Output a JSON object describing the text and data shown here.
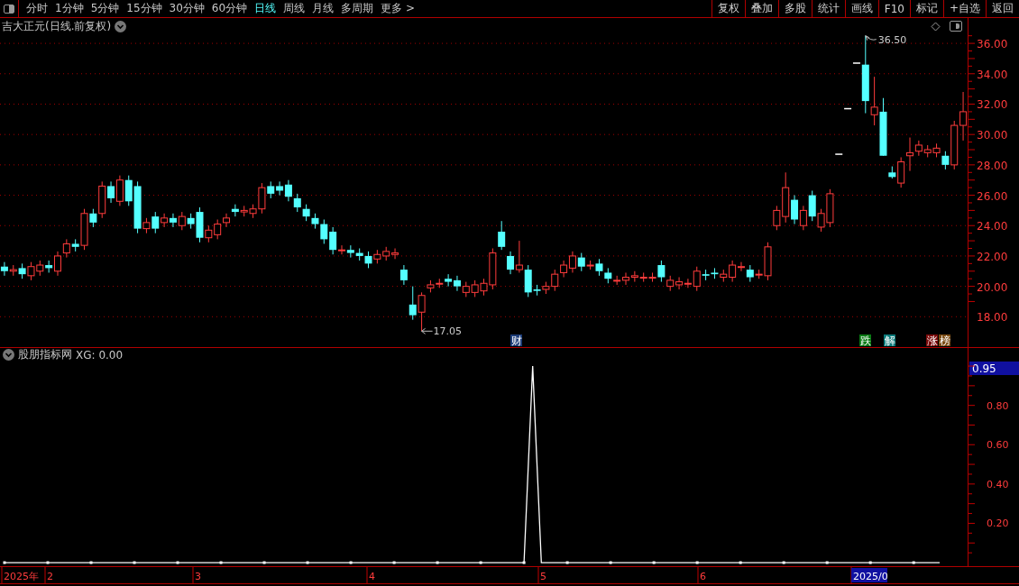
{
  "toolbar": {
    "periods": [
      {
        "label": "分时",
        "selected": false
      },
      {
        "label": "1分钟",
        "selected": false
      },
      {
        "label": "5分钟",
        "selected": false
      },
      {
        "label": "15分钟",
        "selected": false
      },
      {
        "label": "30分钟",
        "selected": false
      },
      {
        "label": "60分钟",
        "selected": false
      },
      {
        "label": "日线",
        "selected": true
      },
      {
        "label": "周线",
        "selected": false
      },
      {
        "label": "月线",
        "selected": false
      },
      {
        "label": "多周期",
        "selected": false
      },
      {
        "label": "更多 >",
        "selected": false
      }
    ],
    "actions": [
      "复权",
      "叠加",
      "多股",
      "统计",
      "画线",
      "F10",
      "标记",
      "+自选",
      "返回"
    ]
  },
  "price_chart": {
    "title": "吉大正元(日线.前复权)",
    "high_label": "36.50",
    "low_label": "17.05",
    "events": [
      {
        "label": "财",
        "color": "#1c3c78"
      },
      {
        "label": "跌",
        "color": "#0a7a14"
      },
      {
        "label": "解",
        "color": "#0a7a7a"
      },
      {
        "label": "涨",
        "color": "#7a0a0a"
      },
      {
        "label": "榜",
        "color": "#7a4a10"
      }
    ],
    "chart_data": {
      "type": "candlestick",
      "ylim": [
        16,
        36.6
      ],
      "grid": true,
      "yticks": [
        {
          "value": 36,
          "label": "36.00"
        },
        {
          "value": 34,
          "label": "34.00"
        },
        {
          "value": 32,
          "label": "32.00"
        },
        {
          "value": 30,
          "label": "30.00"
        },
        {
          "value": 28,
          "label": "28.00"
        },
        {
          "value": 26,
          "label": "26.00"
        },
        {
          "value": 24,
          "label": "24.00"
        },
        {
          "value": 22,
          "label": "22.00"
        },
        {
          "value": 20,
          "label": "20.00"
        },
        {
          "value": 18,
          "label": "18.00"
        }
      ],
      "ohlc": [
        [
          21.3,
          21.6,
          20.7,
          21.0
        ],
        [
          21.0,
          21.4,
          20.7,
          21.1
        ],
        [
          21.2,
          21.5,
          20.5,
          20.8
        ],
        [
          20.7,
          21.6,
          20.4,
          21.3
        ],
        [
          21.0,
          21.7,
          20.7,
          21.4
        ],
        [
          21.4,
          21.7,
          20.9,
          21.2
        ],
        [
          21.0,
          22.3,
          20.7,
          22.0
        ],
        [
          22.2,
          23.1,
          21.9,
          22.8
        ],
        [
          22.8,
          23.1,
          22.3,
          22.6
        ],
        [
          22.7,
          25.1,
          22.4,
          24.8
        ],
        [
          24.8,
          25.1,
          23.9,
          24.2
        ],
        [
          24.8,
          26.9,
          24.5,
          26.6
        ],
        [
          26.6,
          26.9,
          25.5,
          25.8
        ],
        [
          25.6,
          27.3,
          25.3,
          27.0
        ],
        [
          27.0,
          27.3,
          25.3,
          25.6
        ],
        [
          26.6,
          26.9,
          23.5,
          23.8
        ],
        [
          23.8,
          24.5,
          23.5,
          24.2
        ],
        [
          24.6,
          24.9,
          23.5,
          23.8
        ],
        [
          24.2,
          24.8,
          23.9,
          24.5
        ],
        [
          24.5,
          24.8,
          23.9,
          24.2
        ],
        [
          24.0,
          24.9,
          23.7,
          24.6
        ],
        [
          24.5,
          24.8,
          23.8,
          24.1
        ],
        [
          24.9,
          25.2,
          22.9,
          23.2
        ],
        [
          23.2,
          24.0,
          22.9,
          23.7
        ],
        [
          23.4,
          24.4,
          23.1,
          24.1
        ],
        [
          24.2,
          24.8,
          23.9,
          24.5
        ],
        [
          25.1,
          25.4,
          24.6,
          24.9
        ],
        [
          24.9,
          25.3,
          24.6,
          25.0
        ],
        [
          24.8,
          25.4,
          24.5,
          25.1
        ],
        [
          25.1,
          26.8,
          24.8,
          26.5
        ],
        [
          26.6,
          26.9,
          25.8,
          26.1
        ],
        [
          26.6,
          26.9,
          26.0,
          26.3
        ],
        [
          26.7,
          27.0,
          25.6,
          25.9
        ],
        [
          25.8,
          26.1,
          24.9,
          25.2
        ],
        [
          25.1,
          25.4,
          24.3,
          24.6
        ],
        [
          24.5,
          24.8,
          23.8,
          24.1
        ],
        [
          24.1,
          24.4,
          22.8,
          23.1
        ],
        [
          23.6,
          23.9,
          22.1,
          22.4
        ],
        [
          22.4,
          22.7,
          22.1,
          22.4
        ],
        [
          22.4,
          22.7,
          21.9,
          22.2
        ],
        [
          22.2,
          22.5,
          21.7,
          22.0
        ],
        [
          22.0,
          22.3,
          21.2,
          21.5
        ],
        [
          21.8,
          22.4,
          21.5,
          22.1
        ],
        [
          22.0,
          22.6,
          21.7,
          22.3
        ],
        [
          22.1,
          22.5,
          21.8,
          22.2
        ],
        [
          21.1,
          21.4,
          20.1,
          20.4
        ],
        [
          18.8,
          20.0,
          17.8,
          18.1
        ],
        [
          18.3,
          19.6,
          17.05,
          19.4
        ],
        [
          19.9,
          20.4,
          19.6,
          20.1
        ],
        [
          20.2,
          20.5,
          19.9,
          20.2
        ],
        [
          20.5,
          20.8,
          20.0,
          20.3
        ],
        [
          20.4,
          20.7,
          19.7,
          20.0
        ],
        [
          19.6,
          20.3,
          19.3,
          20.0
        ],
        [
          19.6,
          20.4,
          19.3,
          20.1
        ],
        [
          19.7,
          20.5,
          19.4,
          20.2
        ],
        [
          20.1,
          22.5,
          19.8,
          22.2
        ],
        [
          23.6,
          24.3,
          22.4,
          22.6
        ],
        [
          22.0,
          22.3,
          20.8,
          21.1
        ],
        [
          21.1,
          23.0,
          20.9,
          21.4
        ],
        [
          21.1,
          21.4,
          19.3,
          19.6
        ],
        [
          19.8,
          20.1,
          19.4,
          19.7
        ],
        [
          19.8,
          20.3,
          19.5,
          20.0
        ],
        [
          20.0,
          21.1,
          19.7,
          20.8
        ],
        [
          20.9,
          21.7,
          20.6,
          21.4
        ],
        [
          21.2,
          22.3,
          20.9,
          22.0
        ],
        [
          21.9,
          22.2,
          21.0,
          21.3
        ],
        [
          21.4,
          21.7,
          21.1,
          21.4
        ],
        [
          21.5,
          21.8,
          20.7,
          21.0
        ],
        [
          20.9,
          21.2,
          20.2,
          20.5
        ],
        [
          20.4,
          20.7,
          20.1,
          20.4
        ],
        [
          20.4,
          20.9,
          20.1,
          20.6
        ],
        [
          20.6,
          21.0,
          20.3,
          20.7
        ],
        [
          20.6,
          20.9,
          20.3,
          20.6
        ],
        [
          20.6,
          20.9,
          20.3,
          20.6
        ],
        [
          21.4,
          21.7,
          20.3,
          20.6
        ],
        [
          20.0,
          20.7,
          19.7,
          20.4
        ],
        [
          20.1,
          20.6,
          19.8,
          20.3
        ],
        [
          20.2,
          20.5,
          19.9,
          20.2
        ],
        [
          20.0,
          21.3,
          19.7,
          21.0
        ],
        [
          20.8,
          21.1,
          20.4,
          20.7
        ],
        [
          20.9,
          21.2,
          20.5,
          20.8
        ],
        [
          20.6,
          21.1,
          20.3,
          20.8
        ],
        [
          20.6,
          21.7,
          20.3,
          21.4
        ],
        [
          21.3,
          21.6,
          21.0,
          21.3
        ],
        [
          21.1,
          21.4,
          20.3,
          20.6
        ],
        [
          20.8,
          21.1,
          20.5,
          20.8
        ],
        [
          20.7,
          22.9,
          20.4,
          22.6
        ],
        [
          24.0,
          25.3,
          23.7,
          25.0
        ],
        [
          24.6,
          27.5,
          24.2,
          26.5
        ],
        [
          25.7,
          26.0,
          24.1,
          24.4
        ],
        [
          24.0,
          25.3,
          23.7,
          25.0
        ],
        [
          26.0,
          26.3,
          24.3,
          24.6
        ],
        [
          23.9,
          25.1,
          23.6,
          24.8
        ],
        [
          24.2,
          26.4,
          23.9,
          26.1
        ],
        [
          28.7,
          28.7,
          28.7,
          28.7
        ],
        [
          31.7,
          31.7,
          31.7,
          31.7
        ],
        [
          34.7,
          34.7,
          34.7,
          34.7
        ],
        [
          34.6,
          36.5,
          31.4,
          32.2
        ],
        [
          31.3,
          33.8,
          30.6,
          31.8
        ],
        [
          31.5,
          32.4,
          28.6,
          28.6
        ],
        [
          27.5,
          27.9,
          27.1,
          27.2
        ],
        [
          26.8,
          28.5,
          26.5,
          28.2
        ],
        [
          28.6,
          29.8,
          27.6,
          28.8
        ],
        [
          28.9,
          29.6,
          28.6,
          29.3
        ],
        [
          28.8,
          29.3,
          28.5,
          29.0
        ],
        [
          28.8,
          29.4,
          28.5,
          29.1
        ],
        [
          28.6,
          28.9,
          27.7,
          28.0
        ],
        [
          28.0,
          30.9,
          27.7,
          30.6
        ],
        [
          30.6,
          32.8,
          29.6,
          31.5
        ]
      ]
    }
  },
  "indicator": {
    "title": "股朋指标网",
    "readout": "XG: 0.00",
    "cursor_value": "0.95",
    "chart_data": {
      "type": "line",
      "ylim": [
        -0.018,
        1.092
      ],
      "yticks": [
        {
          "value": 0.8,
          "label": "0.80"
        },
        {
          "value": 0.6,
          "label": "0.60"
        },
        {
          "value": 0.4,
          "label": "0.40"
        },
        {
          "value": 0.2,
          "label": "0.20"
        }
      ],
      "series": [
        {
          "color": "#ffffff",
          "values": [
            0,
            0,
            0,
            0,
            0,
            0,
            0,
            0,
            0,
            0,
            0,
            0,
            0,
            0,
            0,
            0,
            0,
            0,
            0,
            0,
            0,
            0,
            0,
            0,
            0,
            0,
            0,
            0,
            0,
            0,
            0,
            0,
            0,
            0,
            0,
            0,
            0,
            0,
            0,
            0,
            0,
            0,
            0,
            0,
            0,
            0,
            0,
            0,
            0,
            0,
            0,
            0,
            0,
            0,
            0,
            0,
            0,
            0,
            0,
            0,
            0,
            1,
            0,
            0,
            0,
            0,
            0,
            0,
            0,
            0,
            0,
            0,
            0,
            0,
            0,
            0,
            0,
            0,
            0,
            0,
            0,
            0,
            0,
            0,
            0,
            0,
            0,
            0,
            0,
            0,
            0,
            0,
            0,
            0,
            0,
            0,
            0,
            0,
            0,
            0,
            0,
            0,
            0,
            0,
            0,
            0,
            0,
            0,
            0
          ]
        }
      ]
    }
  },
  "date_axis": [
    "2025年",
    "2",
    "3",
    "4",
    "5",
    "6",
    "2025/0"
  ]
}
